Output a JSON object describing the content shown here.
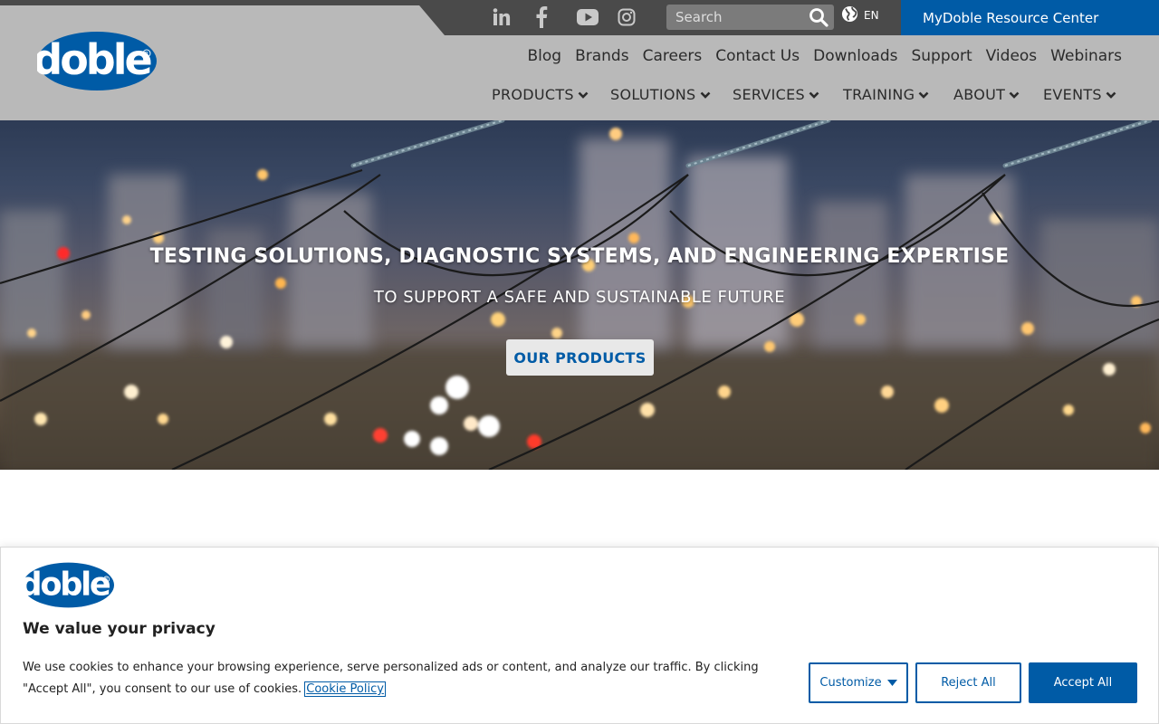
{
  "colors": {
    "brand_blue": "#005ba6",
    "header_gray": "#b9b9b9",
    "topbar_dark": "#4a4a4a",
    "search_bg": "#7b7b7b"
  },
  "topbar": {
    "social_icons": [
      "linkedin-icon",
      "facebook-icon",
      "youtube-icon",
      "instagram-icon"
    ],
    "search_placeholder": "Search",
    "language": "EN",
    "resource_center": "MyDoble Resource Center"
  },
  "logo": {
    "text": "doble"
  },
  "utility_nav": [
    "Blog",
    "Brands",
    "Careers",
    "Contact Us",
    "Downloads",
    "Support",
    "Videos",
    "Webinars"
  ],
  "main_nav": [
    "PRODUCTS",
    "SOLUTIONS",
    "SERVICES",
    "TRAINING",
    "ABOUT",
    "EVENTS"
  ],
  "hero": {
    "title": "TESTING SOLUTIONS, DIAGNOSTIC SYSTEMS, AND ENGINEERING EXPERTISE",
    "subtitle": "TO SUPPORT A SAFE AND SUSTAINABLE FUTURE",
    "button": "OUR PRODUCTS"
  },
  "cookie_banner": {
    "title": "We value your privacy",
    "text": "We use cookies to enhance your browsing experience, serve personalized ads or content, and analyze our traffic. By clicking \"Accept All\", you consent to our use of cookies.",
    "policy_link": "Cookie Policy",
    "customize": "Customize",
    "reject": "Reject All",
    "accept": "Accept All"
  }
}
